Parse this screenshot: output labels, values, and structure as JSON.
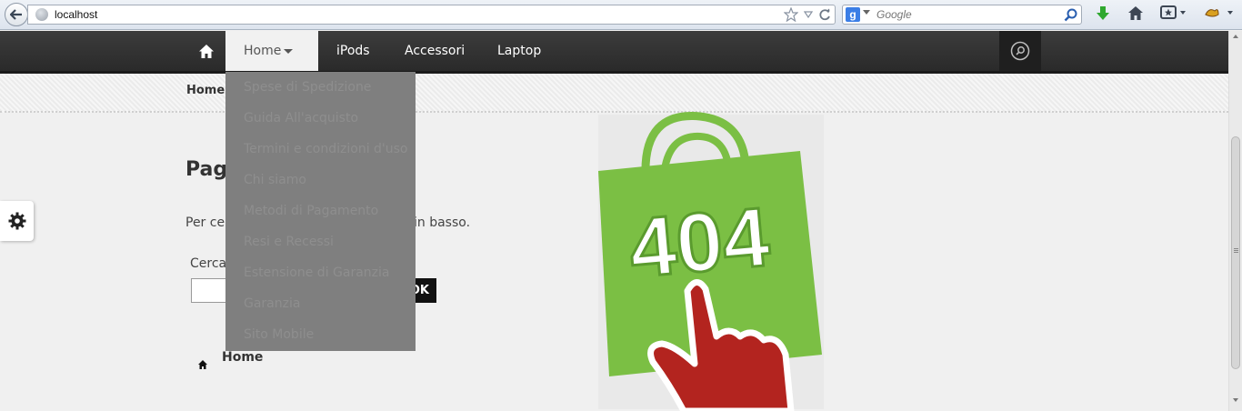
{
  "browser": {
    "url": "localhost",
    "search_engine_logo": "g",
    "search_placeholder": "Google"
  },
  "nav": {
    "home_icon": "home-icon",
    "items": [
      {
        "label": "Home",
        "active": true
      },
      {
        "label": "iPods"
      },
      {
        "label": "Accessori"
      },
      {
        "label": "Laptop"
      }
    ],
    "dropdown": [
      "Spese di Spedizione",
      "Guida All'acquisto",
      "Termini e condizioni d'uso",
      "Chi siamo",
      "Metodi di Pagamento",
      "Resi e Recessi",
      "Estensione di Garanzia",
      "Garanzia",
      "Sito Mobile"
    ]
  },
  "breadcrumb": {
    "home": "Home"
  },
  "main": {
    "title_visible": "Pagi",
    "desc_left": "Per cer",
    "desc_right": "in basso.",
    "search_label": "Cerca",
    "ok_label": "OK",
    "home_link": "Home"
  },
  "illustration": {
    "text": "404",
    "bag_color": "#7bbf44",
    "hand_color": "#b3241f"
  },
  "colors": {
    "nav_bg": "#333333",
    "dropdown_bg": "#7f7f7f",
    "active_tab_bg": "#f1f1f1"
  }
}
